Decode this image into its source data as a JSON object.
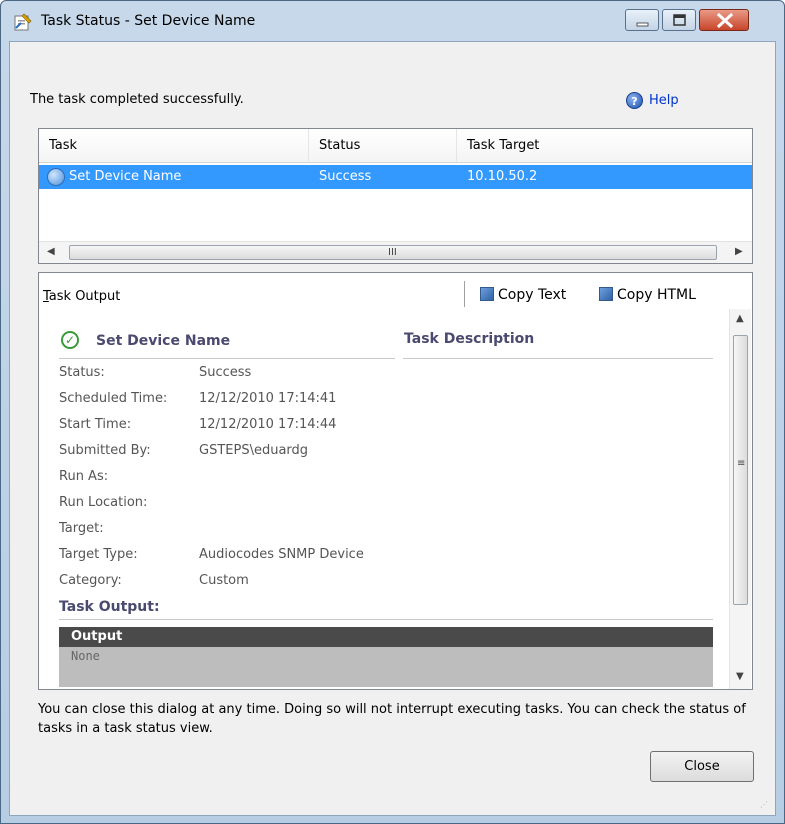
{
  "window": {
    "title": "Task Status - Set Device Name",
    "controls": {
      "minimize_icon": "minimize-icon",
      "maximize_icon": "maximize-icon",
      "close_icon": "close-icon"
    }
  },
  "status_message": "The task completed successfully.",
  "help": {
    "label": "Help",
    "icon": "help-icon"
  },
  "task_table": {
    "columns": [
      "Task",
      "Status",
      "Task Target"
    ],
    "rows": [
      {
        "task": "Set Device Name",
        "status": "Success",
        "target": "10.10.50.2",
        "selected": true
      }
    ],
    "scroll_grip": "III"
  },
  "output_panel": {
    "label": "Task Output",
    "copy_text": "Copy Text",
    "copy_html": "Copy HTML",
    "report": {
      "title": "Set Device Name",
      "description_heading": "Task Description",
      "fields": [
        {
          "label": "Status:",
          "value": "Success"
        },
        {
          "label": "Scheduled Time:",
          "value": "12/12/2010 17:14:41"
        },
        {
          "label": "Start Time:",
          "value": "12/12/2010 17:14:44"
        },
        {
          "label": "Submitted By:",
          "value": "GSTEPS\\eduardg"
        },
        {
          "label": "Run As:",
          "value": ""
        },
        {
          "label": "Run Location:",
          "value": ""
        },
        {
          "label": "Target:",
          "value": ""
        },
        {
          "label": "Target Type:",
          "value": "Audiocodes SNMP Device"
        },
        {
          "label": "Category:",
          "value": "Custom"
        }
      ],
      "output_heading": "Task Output:",
      "output_table_header": "Output",
      "output_value": "None"
    }
  },
  "footer_note": "You can close this dialog at any time.  Doing so will not interrupt executing tasks.  You can check the status of tasks in a task status view.",
  "close_button": "Close",
  "colors": {
    "selection": "#3399ff",
    "heading": "#4a4a70",
    "link": "#0033cc"
  }
}
